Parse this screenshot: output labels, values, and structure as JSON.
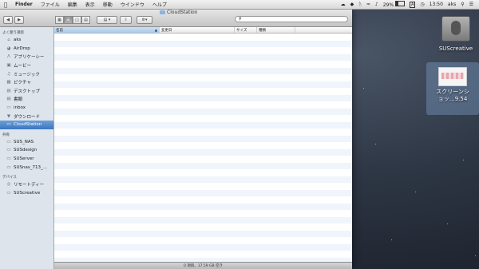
{
  "menubar": {
    "app": "Finder",
    "menus": [
      "ファイル",
      "編集",
      "表示",
      "移動",
      "ウインドウ",
      "ヘルプ"
    ],
    "battery": "29%",
    "input_indicator": "A",
    "time": "13:50",
    "user": "aks"
  },
  "window": {
    "title": "CloudStation",
    "search_placeholder": "",
    "status": "0 項目、17.59 GB 空き"
  },
  "sidebar": {
    "favorites_header": "よく使う項目",
    "favorites": [
      {
        "label": "aks",
        "icon": "home-icon"
      },
      {
        "label": "AirDrop",
        "icon": "airdrop-icon"
      },
      {
        "label": "アプリケーシー",
        "icon": "applications-icon"
      },
      {
        "label": "ムービー",
        "icon": "movies-icon"
      },
      {
        "label": "ミュージック",
        "icon": "music-icon"
      },
      {
        "label": "ピクチャ",
        "icon": "pictures-icon"
      },
      {
        "label": "デスクトップ",
        "icon": "desktop-icon"
      },
      {
        "label": "書類",
        "icon": "documents-icon"
      },
      {
        "label": "inbox",
        "icon": "folder-icon"
      },
      {
        "label": "ダウンロード",
        "icon": "downloads-icon"
      },
      {
        "label": "CloudStation",
        "icon": "folder-icon"
      }
    ],
    "shared_header": "共有",
    "shared": [
      {
        "label": "SUS_NAS",
        "icon": "server-icon"
      },
      {
        "label": "SUSdesign",
        "icon": "server-icon"
      },
      {
        "label": "SUServer",
        "icon": "server-icon"
      },
      {
        "label": "SUSnas_713_...",
        "icon": "server-icon"
      }
    ],
    "devices_header": "デバイス",
    "devices": [
      {
        "label": "リモートディー",
        "icon": "disc-icon"
      },
      {
        "label": "SUScreative",
        "icon": "drive-icon"
      }
    ]
  },
  "columns": [
    "名前",
    "変更日",
    "サイズ",
    "種類"
  ],
  "desktop": {
    "drive_label": "SUScreative",
    "screenshot_label_line1": "スクリーンシ",
    "screenshot_label_line2": "ョッ…9.54"
  }
}
